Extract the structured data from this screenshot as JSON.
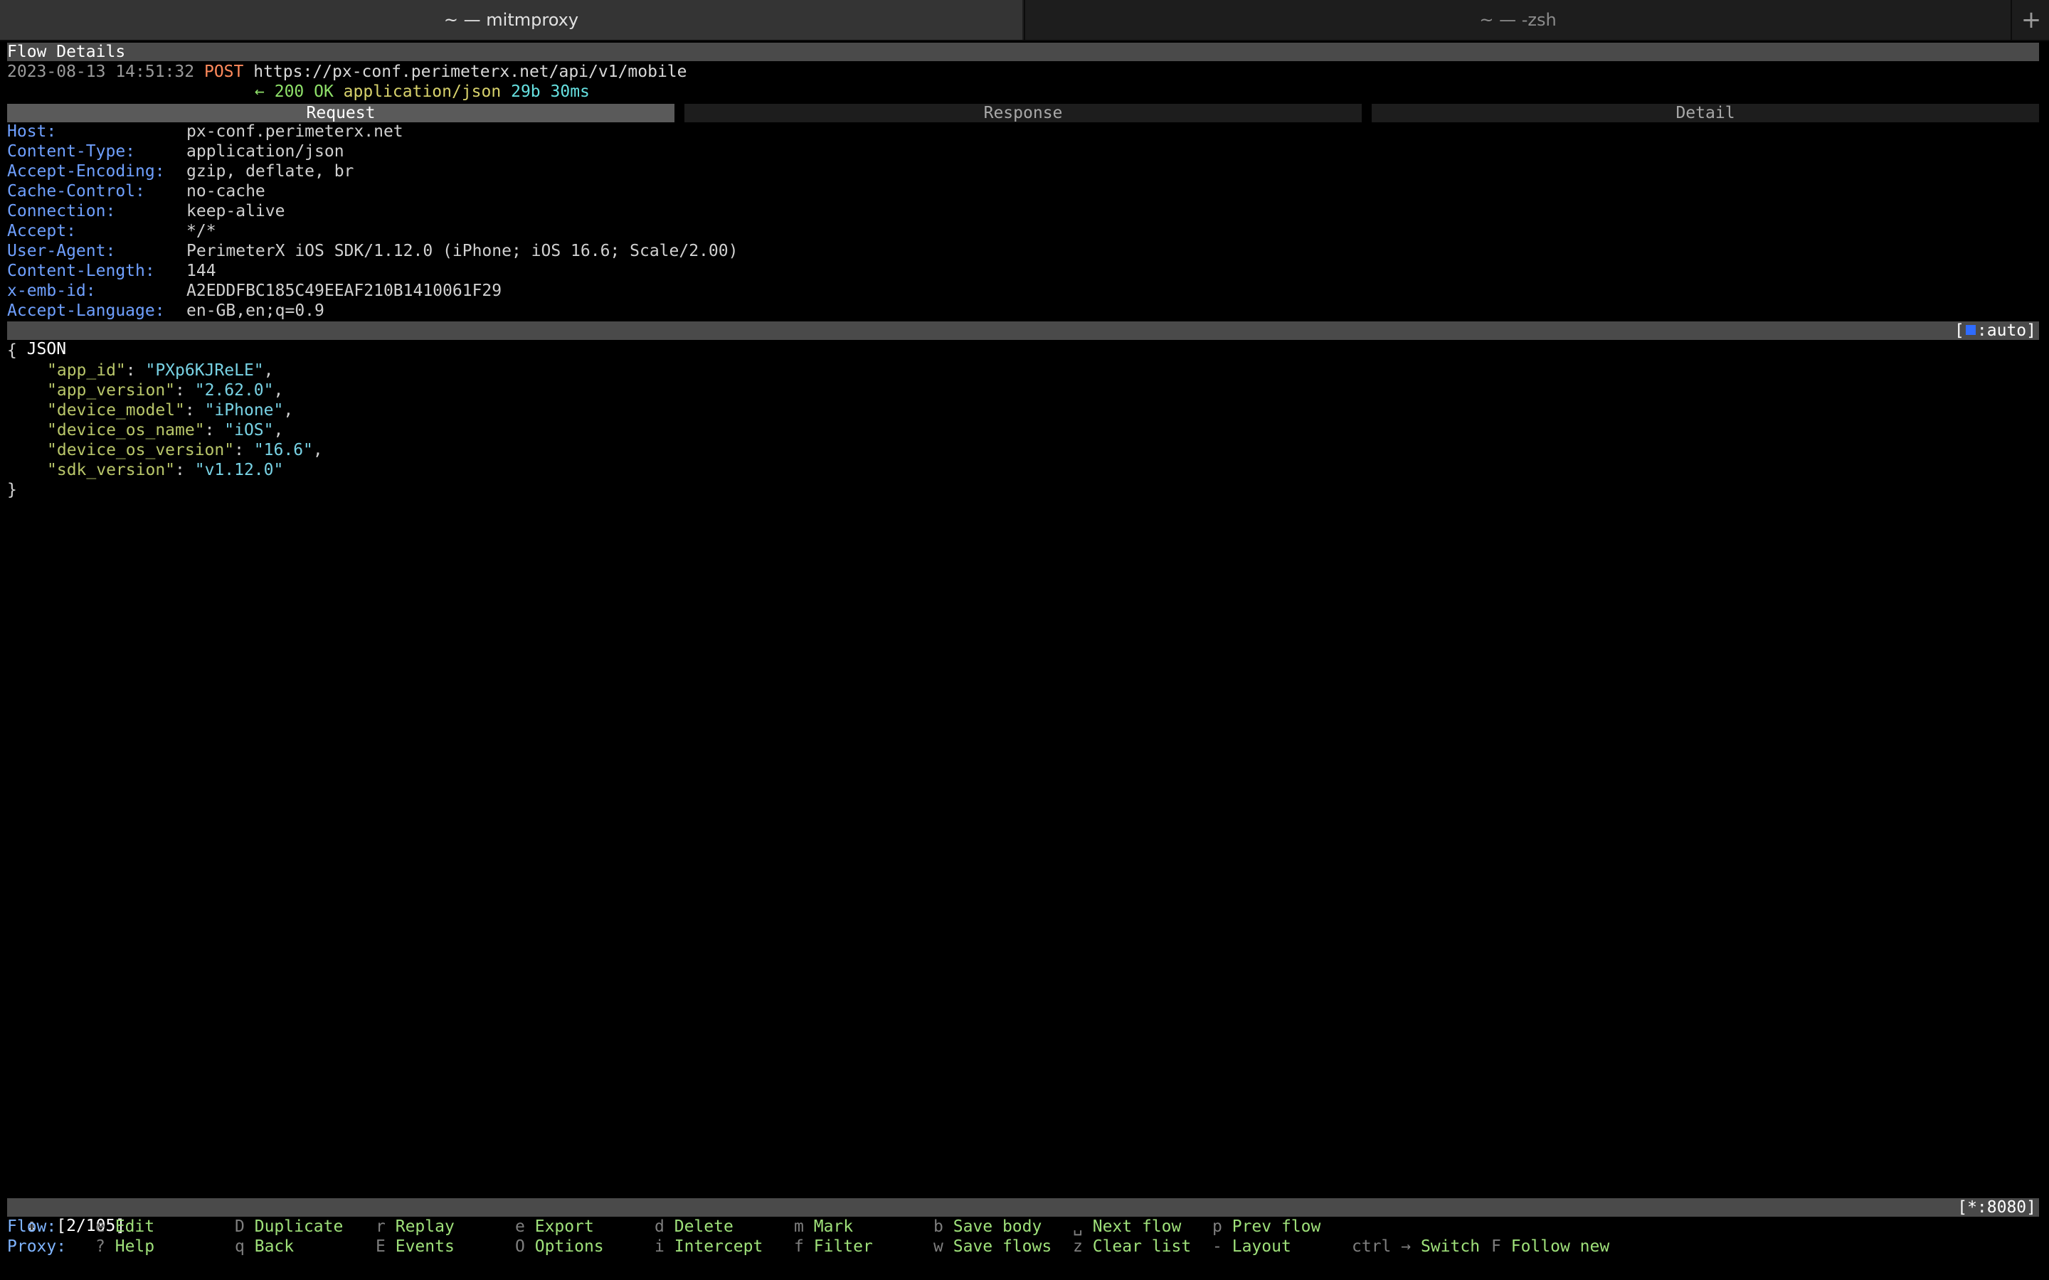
{
  "window": {
    "tabs": [
      {
        "label": "~ — mitmproxy"
      },
      {
        "label": "~ — -zsh"
      }
    ],
    "new_tab": "+"
  },
  "flow": {
    "section_title": "Flow Details",
    "timestamp": "2023-08-13 14:51:32",
    "method": "POST",
    "url": "https://px-conf.perimeterx.net/api/v1/mobile",
    "arrow": "←",
    "status": "200 OK",
    "content_type": "application/json",
    "size": "29b",
    "duration": "30ms"
  },
  "detail_tabs": [
    "Request",
    "Response",
    "Detail"
  ],
  "headers": [
    {
      "name": "Host:",
      "value": "px-conf.perimeterx.net"
    },
    {
      "name": "Content-Type:",
      "value": "application/json"
    },
    {
      "name": "Accept-Encoding:",
      "value": "gzip, deflate, br"
    },
    {
      "name": "Cache-Control:",
      "value": "no-cache"
    },
    {
      "name": "Connection:",
      "value": "keep-alive"
    },
    {
      "name": "Accept:",
      "value": "*/*"
    },
    {
      "name": "User-Agent:",
      "value": "PerimeterX iOS SDK/1.12.0 (iPhone; iOS 16.6; Scale/2.00)"
    },
    {
      "name": "Content-Length:",
      "value": "144"
    },
    {
      "name": "x-emb-id:",
      "value": "A2EDDFBC185C49EEAF210B1410061F29"
    },
    {
      "name": "Accept-Language:",
      "value": "en-GB,en;q=0.9"
    }
  ],
  "body": {
    "view_label": "JSON",
    "view_mode_prefix": "[",
    "view_mode": ":auto]",
    "open_brace": "{",
    "close_brace": "}",
    "entries": [
      {
        "key": "\"app_id\"",
        "value": "\"PXp6KJReLE\"",
        "sep": ","
      },
      {
        "key": "\"app_version\"",
        "value": "\"2.62.0\"",
        "sep": ","
      },
      {
        "key": "\"device_model\"",
        "value": "\"iPhone\"",
        "sep": ","
      },
      {
        "key": "\"device_os_name\"",
        "value": "\"iOS\"",
        "sep": ","
      },
      {
        "key": "\"device_os_version\"",
        "value": "\"16.6\"",
        "sep": ","
      },
      {
        "key": "\"sdk_version\"",
        "value": "\"v1.12.0\"",
        "sep": ""
      }
    ]
  },
  "status_bar": {
    "arrow": "⇩",
    "position": "[2/105]",
    "listen": "[*:8080]"
  },
  "keybindings": {
    "flow_label": "Flow:",
    "proxy_label": "Proxy:",
    "flow": [
      {
        "key": "e",
        "label": "Edit"
      },
      {
        "key": "D",
        "label": "Duplicate"
      },
      {
        "key": "r",
        "label": "Replay"
      },
      {
        "key": "e",
        "label": "Export"
      },
      {
        "key": "d",
        "label": "Delete"
      },
      {
        "key": "m",
        "label": "Mark"
      },
      {
        "key": "b",
        "label": "Save body"
      },
      {
        "key": "␣",
        "label": "Next flow"
      },
      {
        "key": "p",
        "label": "Prev flow"
      }
    ],
    "proxy": [
      {
        "key": "?",
        "label": "Help"
      },
      {
        "key": "q",
        "label": "Back"
      },
      {
        "key": "E",
        "label": "Events"
      },
      {
        "key": "O",
        "label": "Options"
      },
      {
        "key": "i",
        "label": "Intercept"
      },
      {
        "key": "f",
        "label": "Filter"
      },
      {
        "key": "w",
        "label": "Save flows"
      },
      {
        "key": "z",
        "label": "Clear list"
      },
      {
        "key": "-",
        "label": "Layout"
      },
      {
        "key": "ctrl →",
        "label": "Switch"
      },
      {
        "key": "F",
        "label": "Follow new"
      }
    ]
  }
}
